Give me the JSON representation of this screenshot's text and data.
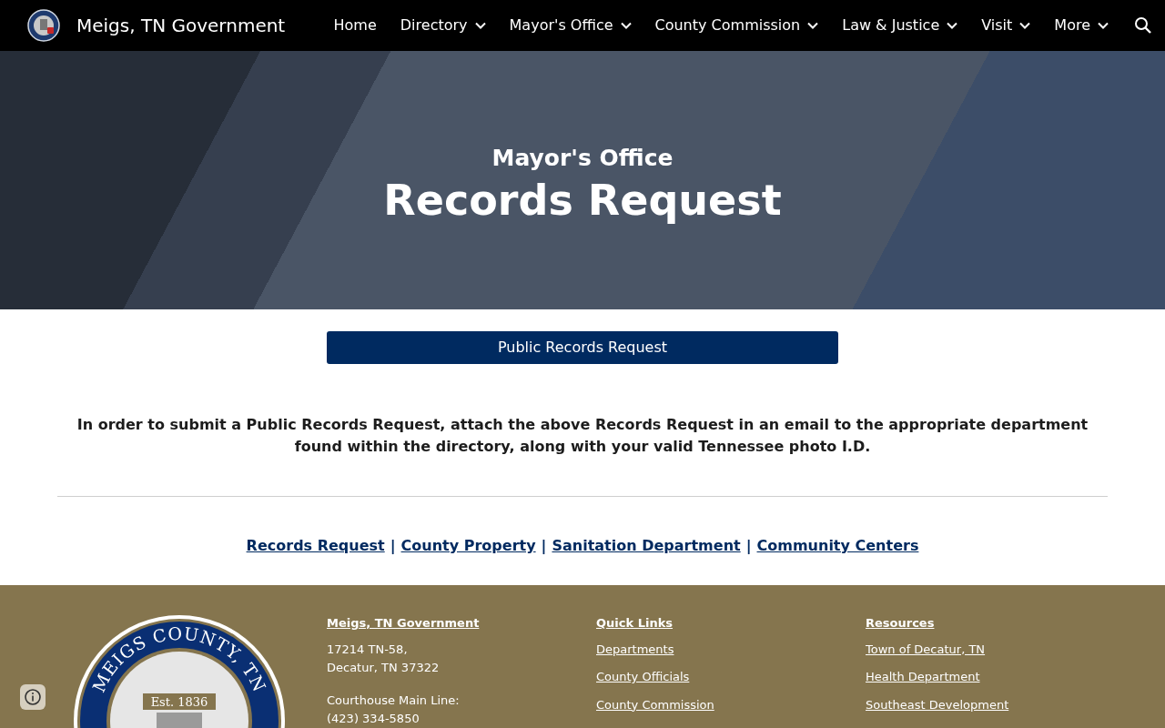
{
  "header": {
    "site_title": "Meigs, TN Government",
    "nav": [
      {
        "label": "Home",
        "has_menu": false
      },
      {
        "label": "Directory",
        "has_menu": true
      },
      {
        "label": "Mayor's Office",
        "has_menu": true
      },
      {
        "label": "County Commission",
        "has_menu": true
      },
      {
        "label": "Law & Justice",
        "has_menu": true
      },
      {
        "label": "Visit",
        "has_menu": true
      },
      {
        "label": "More",
        "has_menu": true
      }
    ]
  },
  "hero": {
    "subtitle": "Mayor's Office",
    "title": "Records Request"
  },
  "main": {
    "button": "Public Records Request",
    "paragraph": "In order to submit a Public Records Request, attach the above Records Request in an email to the appropriate department found within the directory, along with your valid Tennessee photo I.D.",
    "links": [
      "Records Request",
      "County Property",
      "Sanitation Department",
      "Community Centers"
    ],
    "separator": "|"
  },
  "footer": {
    "seal": {
      "ring_text": "MEIGS COUNTY, TN",
      "est": "Est. 1836"
    },
    "columns": [
      {
        "heading": "Meigs, TN Government",
        "lines": [
          {
            "kind": "text",
            "text": "17214 TN-58,"
          },
          {
            "kind": "text",
            "text": "Decatur, TN 37322"
          },
          {
            "kind": "gap"
          },
          {
            "kind": "text",
            "text": "Courthouse Main Line:"
          },
          {
            "kind": "text",
            "text": "(423) 334-5850"
          }
        ]
      },
      {
        "heading": "Quick Links",
        "lines": [
          {
            "kind": "link",
            "text": "Departments"
          },
          {
            "kind": "link",
            "text": "County Officials"
          },
          {
            "kind": "link",
            "text": "County Commission"
          }
        ]
      },
      {
        "heading": "Resources",
        "lines": [
          {
            "kind": "link",
            "text": "Town of Decatur, TN"
          },
          {
            "kind": "link",
            "text": "Health Department"
          },
          {
            "kind": "link",
            "text": "Southeast Development"
          }
        ]
      }
    ]
  }
}
